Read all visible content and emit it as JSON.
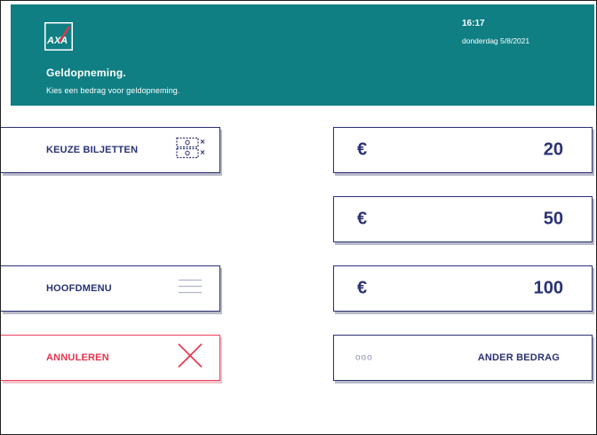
{
  "header": {
    "title": "Geldopneming.",
    "subtitle": "Kies een bedrag voor geldopneming.",
    "time": "16:17",
    "date": "donderdag 5/8/2021",
    "logo_text": "AXA"
  },
  "buttons": {
    "keuze_biljetten": "KEUZE BILJETTEN",
    "hoofdmenu": "HOOFDMENU",
    "annuleren": "ANNULEREN"
  },
  "amounts": [
    {
      "currency": "€",
      "value": "20"
    },
    {
      "currency": "€",
      "value": "50"
    },
    {
      "currency": "€",
      "value": "100"
    }
  ],
  "other_amount": {
    "dots": "ooo",
    "label": "ANDER BEDRAG"
  },
  "icons": {
    "banknotes": "banknotes-icon",
    "menu": "menu-icon",
    "cancel": "close-icon"
  },
  "colors": {
    "header_bg": "#0f7f84",
    "primary": "#2a3274",
    "cancel": "#e8334d"
  }
}
